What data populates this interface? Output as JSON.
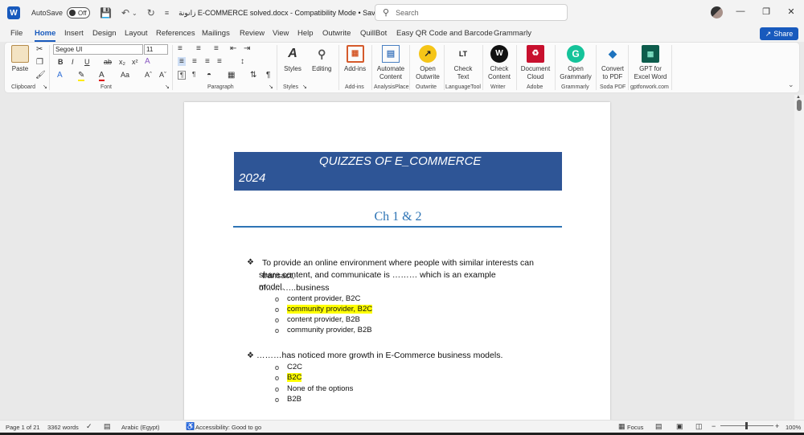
{
  "titlebar": {
    "logo": "W",
    "autosave_label": "AutoSave",
    "autosave_state": "Off",
    "doc_title": "زانونة E-COMMERCE solved.docx  -  Compatibility Mode  •  Saved",
    "search_placeholder": "Search"
  },
  "menu": {
    "tabs": [
      "File",
      "Home",
      "Insert",
      "Design",
      "Layout",
      "References",
      "Mailings",
      "Review",
      "View",
      "Help",
      "Outwrite",
      "QuillBot",
      "Easy QR Code and Barcode",
      "Grammarly"
    ],
    "active": "Home",
    "share_label": "Share"
  },
  "ribbon": {
    "font_name": "Segoe UI",
    "font_size": "11",
    "paste_label": "Paste",
    "styles_label": "Styles",
    "editing_label": "Editing",
    "addins_label": "Add-ins",
    "automate_label": "Automate Content",
    "open_outwrite_label": "Open Outwrite",
    "check_text_label": "Check Text",
    "check_content_label": "Check Content",
    "document_cloud_label": "Document Cloud",
    "open_grammarly_label": "Open Grammarly",
    "convert_pdf_label": "Convert to PDF",
    "gpt_label": "GPT for Excel Word",
    "groups": [
      "Clipboard",
      "Font",
      "Paragraph",
      "Styles",
      "Add-ins",
      "AnalysisPlace",
      "Outwrite",
      "LanguageTool",
      "Writer",
      "Adobe",
      "Grammarly",
      "Soda PDF",
      "gptforwork.com"
    ]
  },
  "document": {
    "banner_line1": "QUIZZES OF E_COMMERCE",
    "banner_line2": "2024",
    "chapter_title": "Ch 1 & 2",
    "q1_line1": "To provide an online environment where people with similar interests can transact,",
    "q1_line2": "share content, and communicate is ……… which is an example of………..business",
    "q1_line3": "model.",
    "q1_options": [
      "content provider, B2C",
      "community provider, B2C",
      "content provider, B2B",
      "community provider, B2B"
    ],
    "q2_text": "………has noticed more growth in E-Commerce business models.",
    "q2_options": [
      "C2C",
      "B2C",
      "None of the options",
      "B2B"
    ]
  },
  "status": {
    "page": "Page 1 of 21",
    "words": "3362 words",
    "language": "Arabic (Egypt)",
    "accessibility": "Accessibility: Good to go",
    "focus": "Focus",
    "zoom": "100%"
  }
}
